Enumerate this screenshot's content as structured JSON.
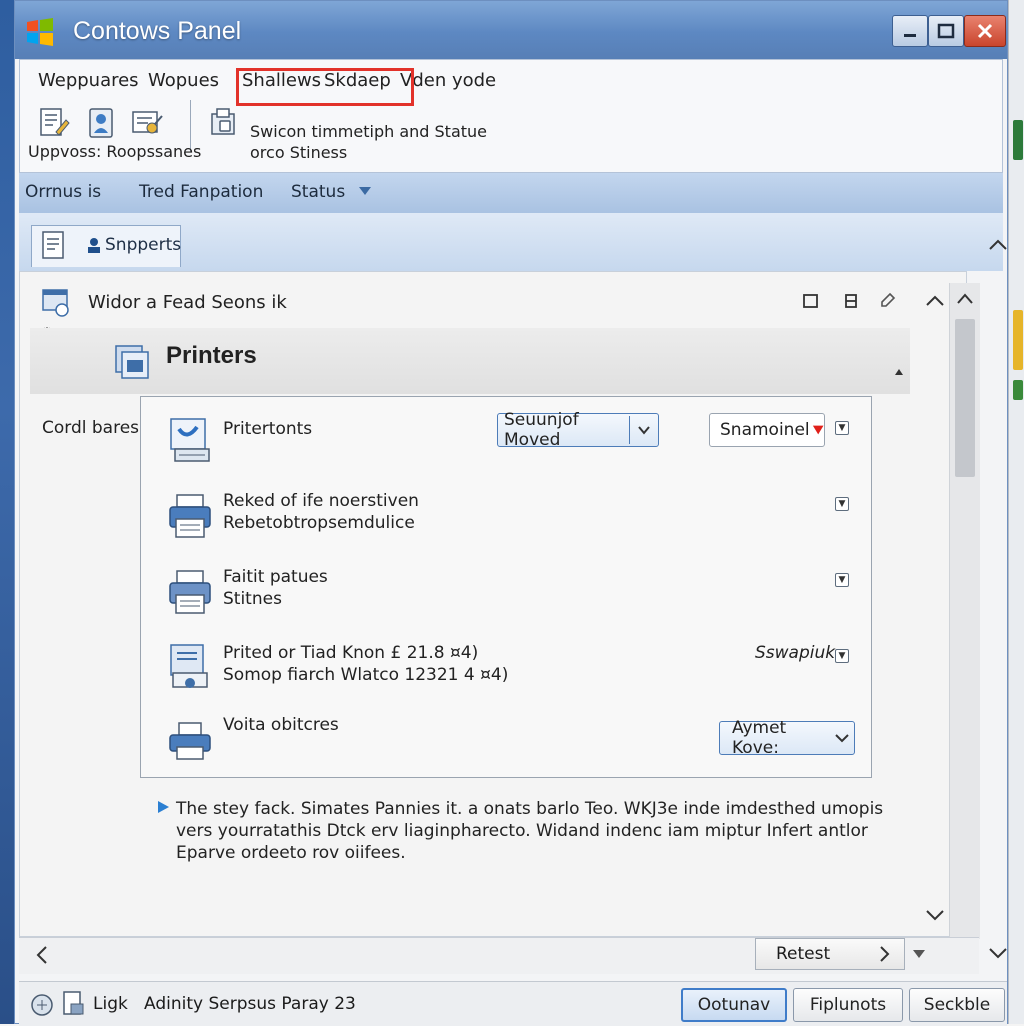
{
  "window": {
    "title": "Contows Panel",
    "accent": "#5d88c2",
    "close_color": "#d4513a"
  },
  "menu": {
    "items": [
      "Weppuares",
      "Wopues",
      "Shallews",
      "Skdaep",
      "Vden yode"
    ],
    "highlight_color": "#e2322a"
  },
  "ribbon": {
    "left_caption": "Uppvoss: Roopssanes",
    "right_line1": "Swicon timmetiph and Statue",
    "right_line2": "orco Stiness",
    "icons": [
      "document-edit-icon",
      "user-card-icon",
      "certificate-edit-icon",
      "security-folder-icon"
    ]
  },
  "nav": {
    "items": [
      "Orrnus is",
      "Tred Fanpation",
      "Status"
    ]
  },
  "tab": {
    "label": "Snpperts"
  },
  "panel": {
    "title": "Widor a Fead Seons ik",
    "heading": "Printers",
    "left_label": "Cordl bares",
    "rows": [
      {
        "line1": "Pritertonts",
        "line2": "",
        "dropdown": "Seuunjof Moved",
        "select": "Snamoinel"
      },
      {
        "line1": "Reked of ife noerstiven",
        "line2": "Rebetobtropsemdulice"
      },
      {
        "line1": "Faitit patues",
        "line2": "Stitnes"
      },
      {
        "line1": "Prited or Tiad Knon £ 21.8 ¤4)",
        "line2": "Somop fiarch Wlatco 12321 4 ¤4)",
        "side_label": "Sswapiuk"
      },
      {
        "line1": "Voita obitcres",
        "line2": "",
        "dropdown": "Aymet Kove:"
      }
    ],
    "info_text": "The stey fack. Simates Pannies it. a onats barlo Teo. WKJ3e inde imdesthed umopis vers yourratathis Dtck erv liaginpharecto. Widand indenc iam miptur Infert antlor Eparve ordeeto rov oiifees."
  },
  "bottom": {
    "reset_label": "Retest"
  },
  "statusbar": {
    "text": "Ligk   Adinity Serpsus Paray 23",
    "buttons": [
      "Ootunav",
      "Fiplunots",
      "Seckble"
    ]
  }
}
